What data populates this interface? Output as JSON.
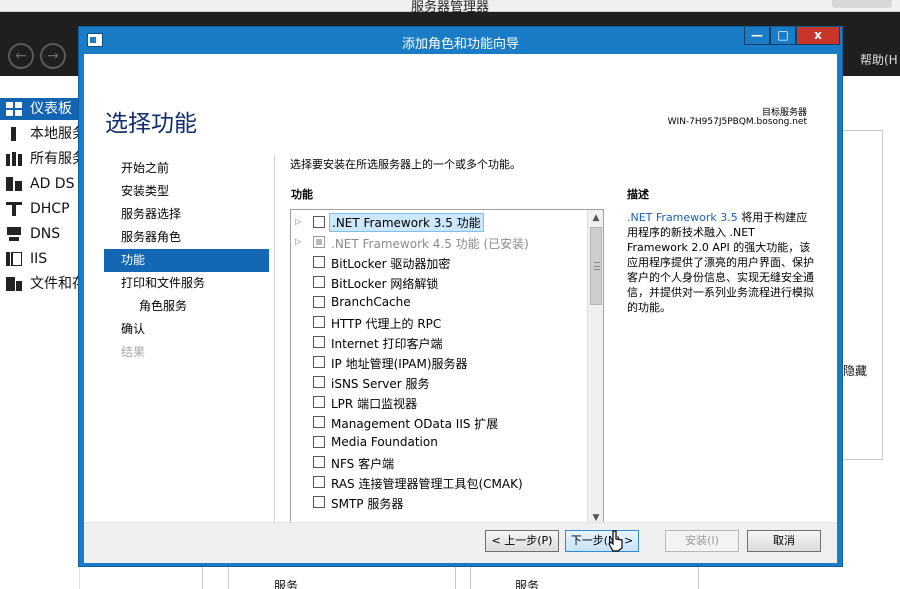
{
  "background": {
    "window_title": "服务器管理器",
    "help_menu": "帮助(H",
    "sidebar": [
      {
        "label": "仪表板",
        "active": true,
        "icon": "dashboard-icon"
      },
      {
        "label": "本地服务",
        "active": false,
        "icon": "local-server-icon"
      },
      {
        "label": "所有服务",
        "active": false,
        "icon": "all-servers-icon"
      },
      {
        "label": "AD DS",
        "active": false,
        "icon": "ad-ds-icon"
      },
      {
        "label": "DHCP",
        "active": false,
        "icon": "dhcp-icon"
      },
      {
        "label": "DNS",
        "active": false,
        "icon": "dns-icon"
      },
      {
        "label": "IIS",
        "active": false,
        "icon": "iis-icon"
      },
      {
        "label": "文件和存",
        "active": false,
        "icon": "file-storage-icon"
      }
    ],
    "right_panel_text": "隐藏",
    "bottom_labels": [
      "服务",
      "服务"
    ]
  },
  "wizard": {
    "title": "添加角色和功能向导",
    "page_title": "选择功能",
    "destination_label": "目标服务器",
    "destination_server": "WIN-7H957J5PBQM.bosong.net",
    "steps": [
      {
        "label": "开始之前",
        "state": "normal",
        "sub": false
      },
      {
        "label": "安装类型",
        "state": "normal",
        "sub": false
      },
      {
        "label": "服务器选择",
        "state": "normal",
        "sub": false
      },
      {
        "label": "服务器角色",
        "state": "normal",
        "sub": false
      },
      {
        "label": "功能",
        "state": "active",
        "sub": false
      },
      {
        "label": "打印和文件服务",
        "state": "normal",
        "sub": false
      },
      {
        "label": "角色服务",
        "state": "normal",
        "sub": true
      },
      {
        "label": "确认",
        "state": "normal",
        "sub": false
      },
      {
        "label": "结果",
        "state": "disabled",
        "sub": false
      }
    ],
    "instruction": "选择要安装在所选服务器上的一个或多个功能。",
    "features_heading": "功能",
    "description_heading": "描述",
    "features": [
      {
        "label": ".NET Framework 3.5 功能",
        "expandable": true,
        "checkbox": "unchecked",
        "selected": true,
        "grey": false
      },
      {
        "label": ".NET Framework 4.5 功能 (已安装)",
        "expandable": true,
        "checkbox": "partial",
        "selected": false,
        "grey": true
      },
      {
        "label": "BitLocker 驱动器加密",
        "expandable": false,
        "checkbox": "unchecked",
        "selected": false,
        "grey": false
      },
      {
        "label": "BitLocker 网络解锁",
        "expandable": false,
        "checkbox": "unchecked",
        "selected": false,
        "grey": false
      },
      {
        "label": "BranchCache",
        "expandable": false,
        "checkbox": "unchecked",
        "selected": false,
        "grey": false
      },
      {
        "label": "HTTP 代理上的 RPC",
        "expandable": false,
        "checkbox": "unchecked",
        "selected": false,
        "grey": false
      },
      {
        "label": "Internet 打印客户端",
        "expandable": false,
        "checkbox": "unchecked",
        "selected": false,
        "grey": false
      },
      {
        "label": "IP 地址管理(IPAM)服务器",
        "expandable": false,
        "checkbox": "unchecked",
        "selected": false,
        "grey": false
      },
      {
        "label": "iSNS Server 服务",
        "expandable": false,
        "checkbox": "unchecked",
        "selected": false,
        "grey": false
      },
      {
        "label": "LPR 端口监视器",
        "expandable": false,
        "checkbox": "unchecked",
        "selected": false,
        "grey": false
      },
      {
        "label": "Management OData IIS 扩展",
        "expandable": false,
        "checkbox": "unchecked",
        "selected": false,
        "grey": false
      },
      {
        "label": "Media Foundation",
        "expandable": false,
        "checkbox": "unchecked",
        "selected": false,
        "grey": false
      },
      {
        "label": "NFS 客户端",
        "expandable": false,
        "checkbox": "unchecked",
        "selected": false,
        "grey": false
      },
      {
        "label": "RAS 连接管理器管理工具包(CMAK)",
        "expandable": false,
        "checkbox": "unchecked",
        "selected": false,
        "grey": false
      },
      {
        "label": "SMTP 服务器",
        "expandable": false,
        "checkbox": "unchecked",
        "selected": false,
        "grey": false
      }
    ],
    "description_link": ".NET Framework 3.5",
    "description_text": " 将用于构建应用程序的新技术融入 .NET Framework 2.0 API 的强大功能，该应用程序提供了漂亮的用户界面、保护客户的个人身份信息、实现无缝安全通信，并提供对一系列业务流程进行模拟的功能。",
    "buttons": {
      "previous": "< 上一步(P)",
      "next": "下一步(N) >",
      "install": "安装(I)",
      "cancel": "取消"
    },
    "window_controls": {
      "minimize": "—",
      "maximize": "□",
      "close": "x"
    }
  },
  "colors": {
    "wizard_border": "#1a7cc6",
    "active_step": "#1467b4",
    "page_title": "#0e2d6e",
    "close_button": "#c7352b"
  }
}
